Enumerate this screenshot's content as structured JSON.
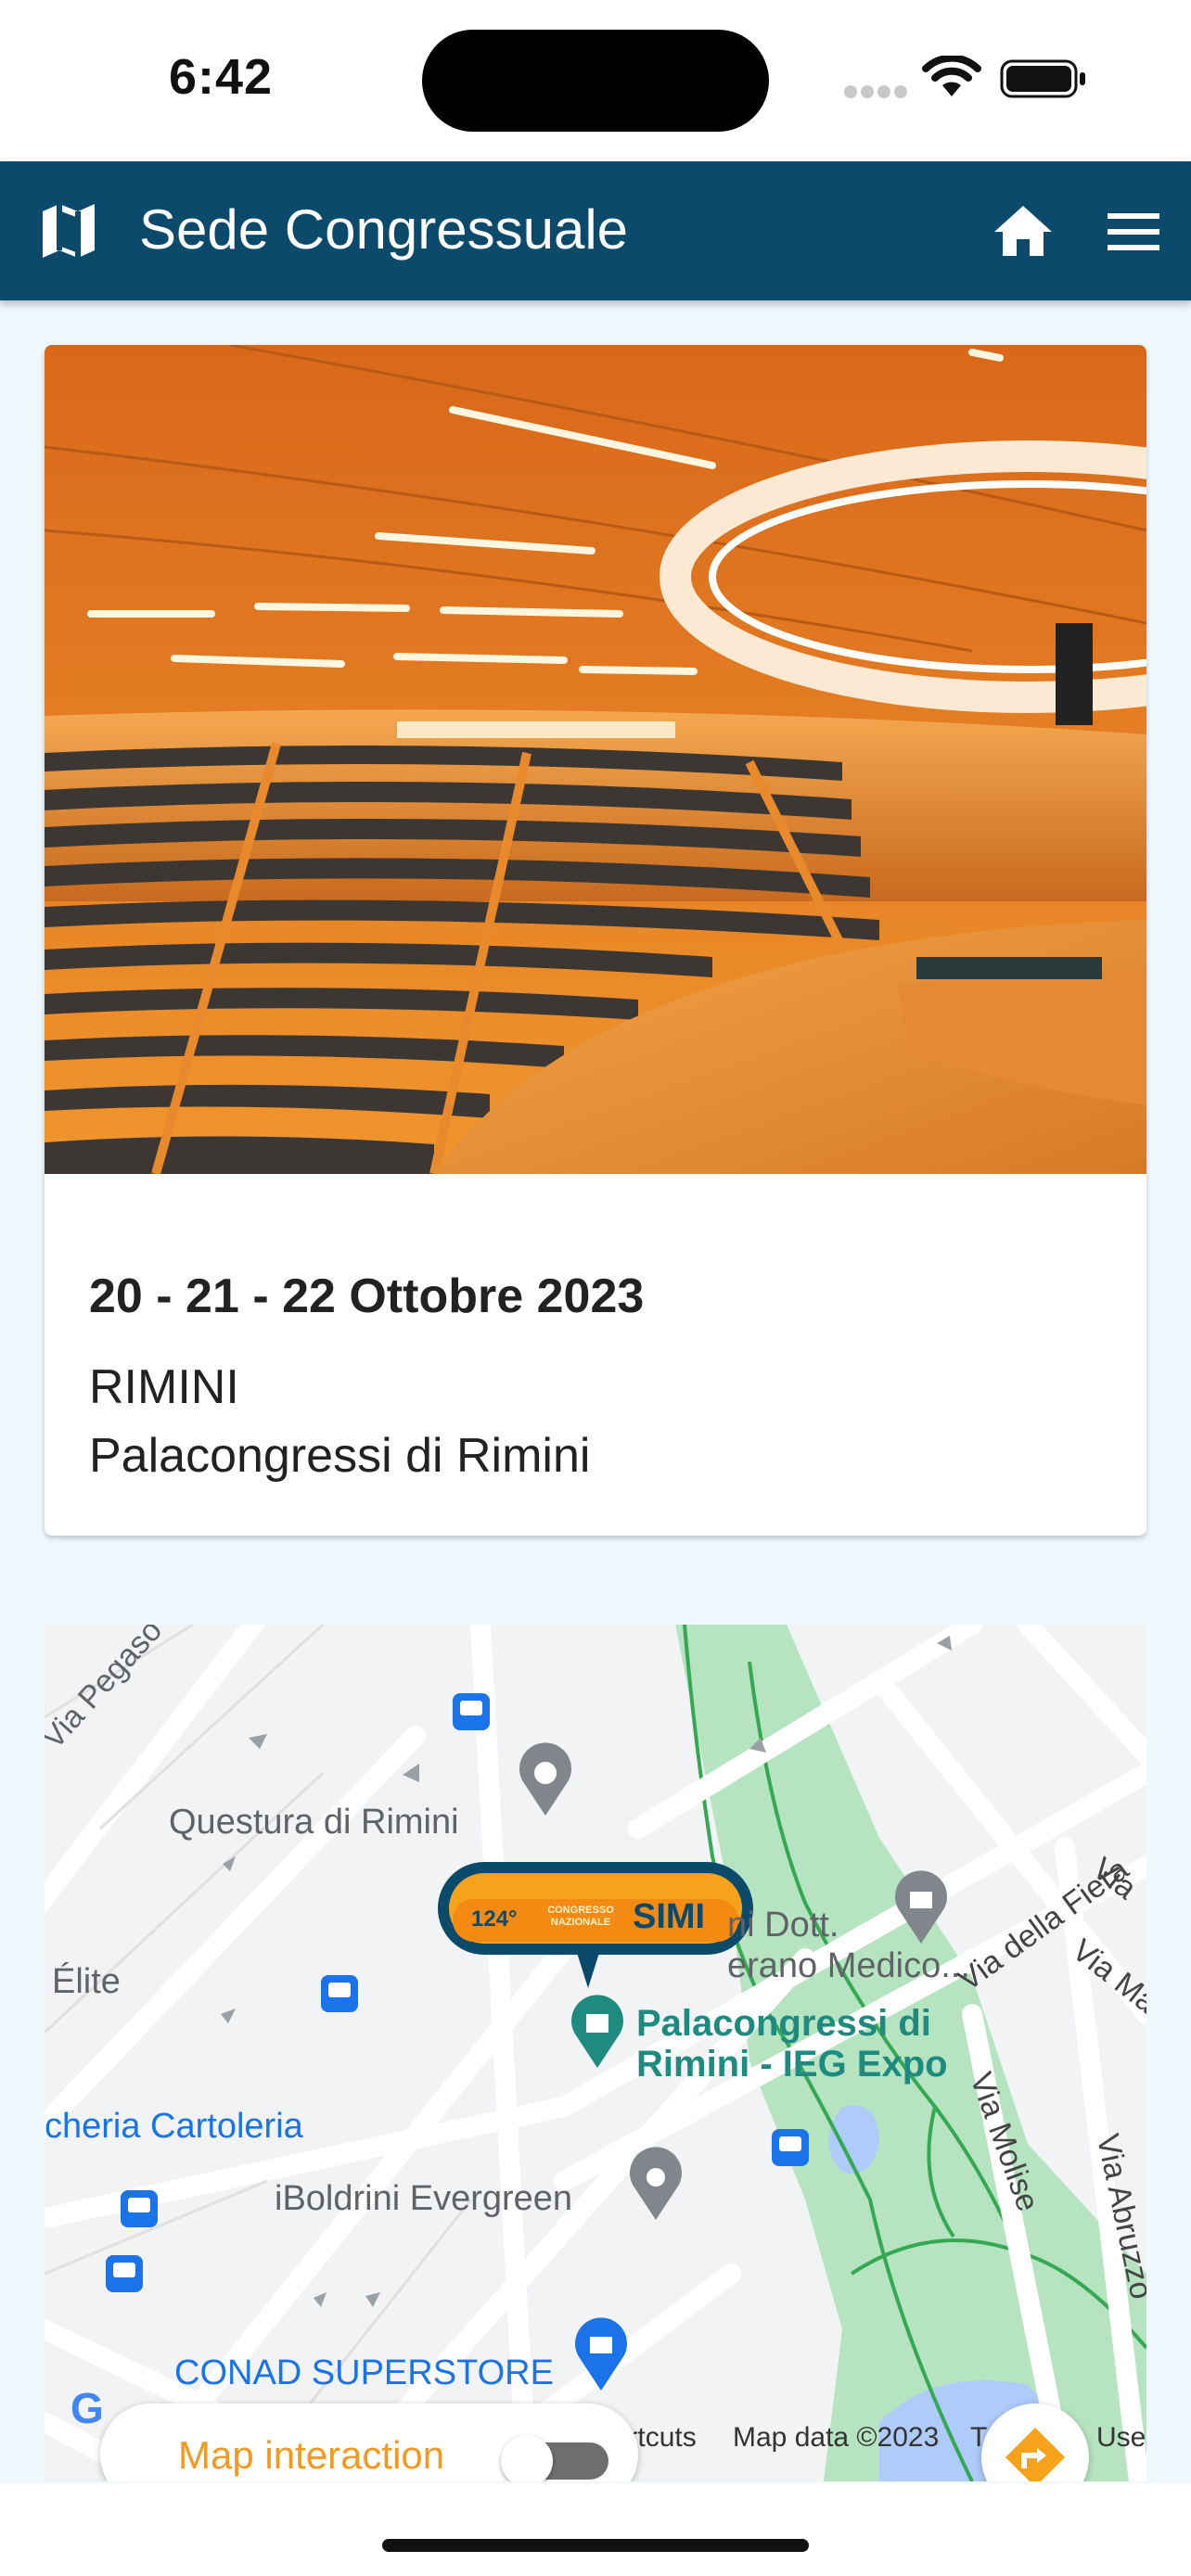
{
  "status_bar": {
    "time": "6:42"
  },
  "app_bar": {
    "title": "Sede Congressuale"
  },
  "venue_card": {
    "dates": "20 - 21 - 22 Ottobre 2023",
    "city": "RIMINI",
    "venue": "Palacongressi di Rimini"
  },
  "map": {
    "labels": {
      "via_pegaso": "Via Pegaso",
      "questura": "Questura di Rimini",
      "elite": "Élite",
      "cartoleria": "cheria Cartoleria",
      "ordine_medici": "ni Dott.\nerano Medico...",
      "palacongressi": "Palacongressi di\nRimini - IEG Expo",
      "via_della_fiera": "Via della Fiera",
      "via_right": "Via",
      "via_ma": "Via Ma",
      "via_molise": "Via Molise",
      "via_abruzzo": "Via Abruzzo",
      "iboldrini": "iBoldrini Evergreen",
      "conad": "CONAD SUPERSTORE"
    },
    "marker_text": {
      "number": "124°",
      "small": "CONGRESSO NAZIONALE",
      "brand": "SIMI"
    },
    "toggle_label": "Map interaction",
    "toggle_on": false,
    "attribution": {
      "shortcuts": "hortcuts",
      "map_data": "Map data ©2023",
      "terms": "T",
      "use": "Use"
    },
    "google_logo_letter": "G"
  },
  "colors": {
    "app_bar": "#0b4a6b",
    "background": "#eef8fd",
    "accent_orange": "#f29a20",
    "map_marker": "#1e8a80"
  }
}
